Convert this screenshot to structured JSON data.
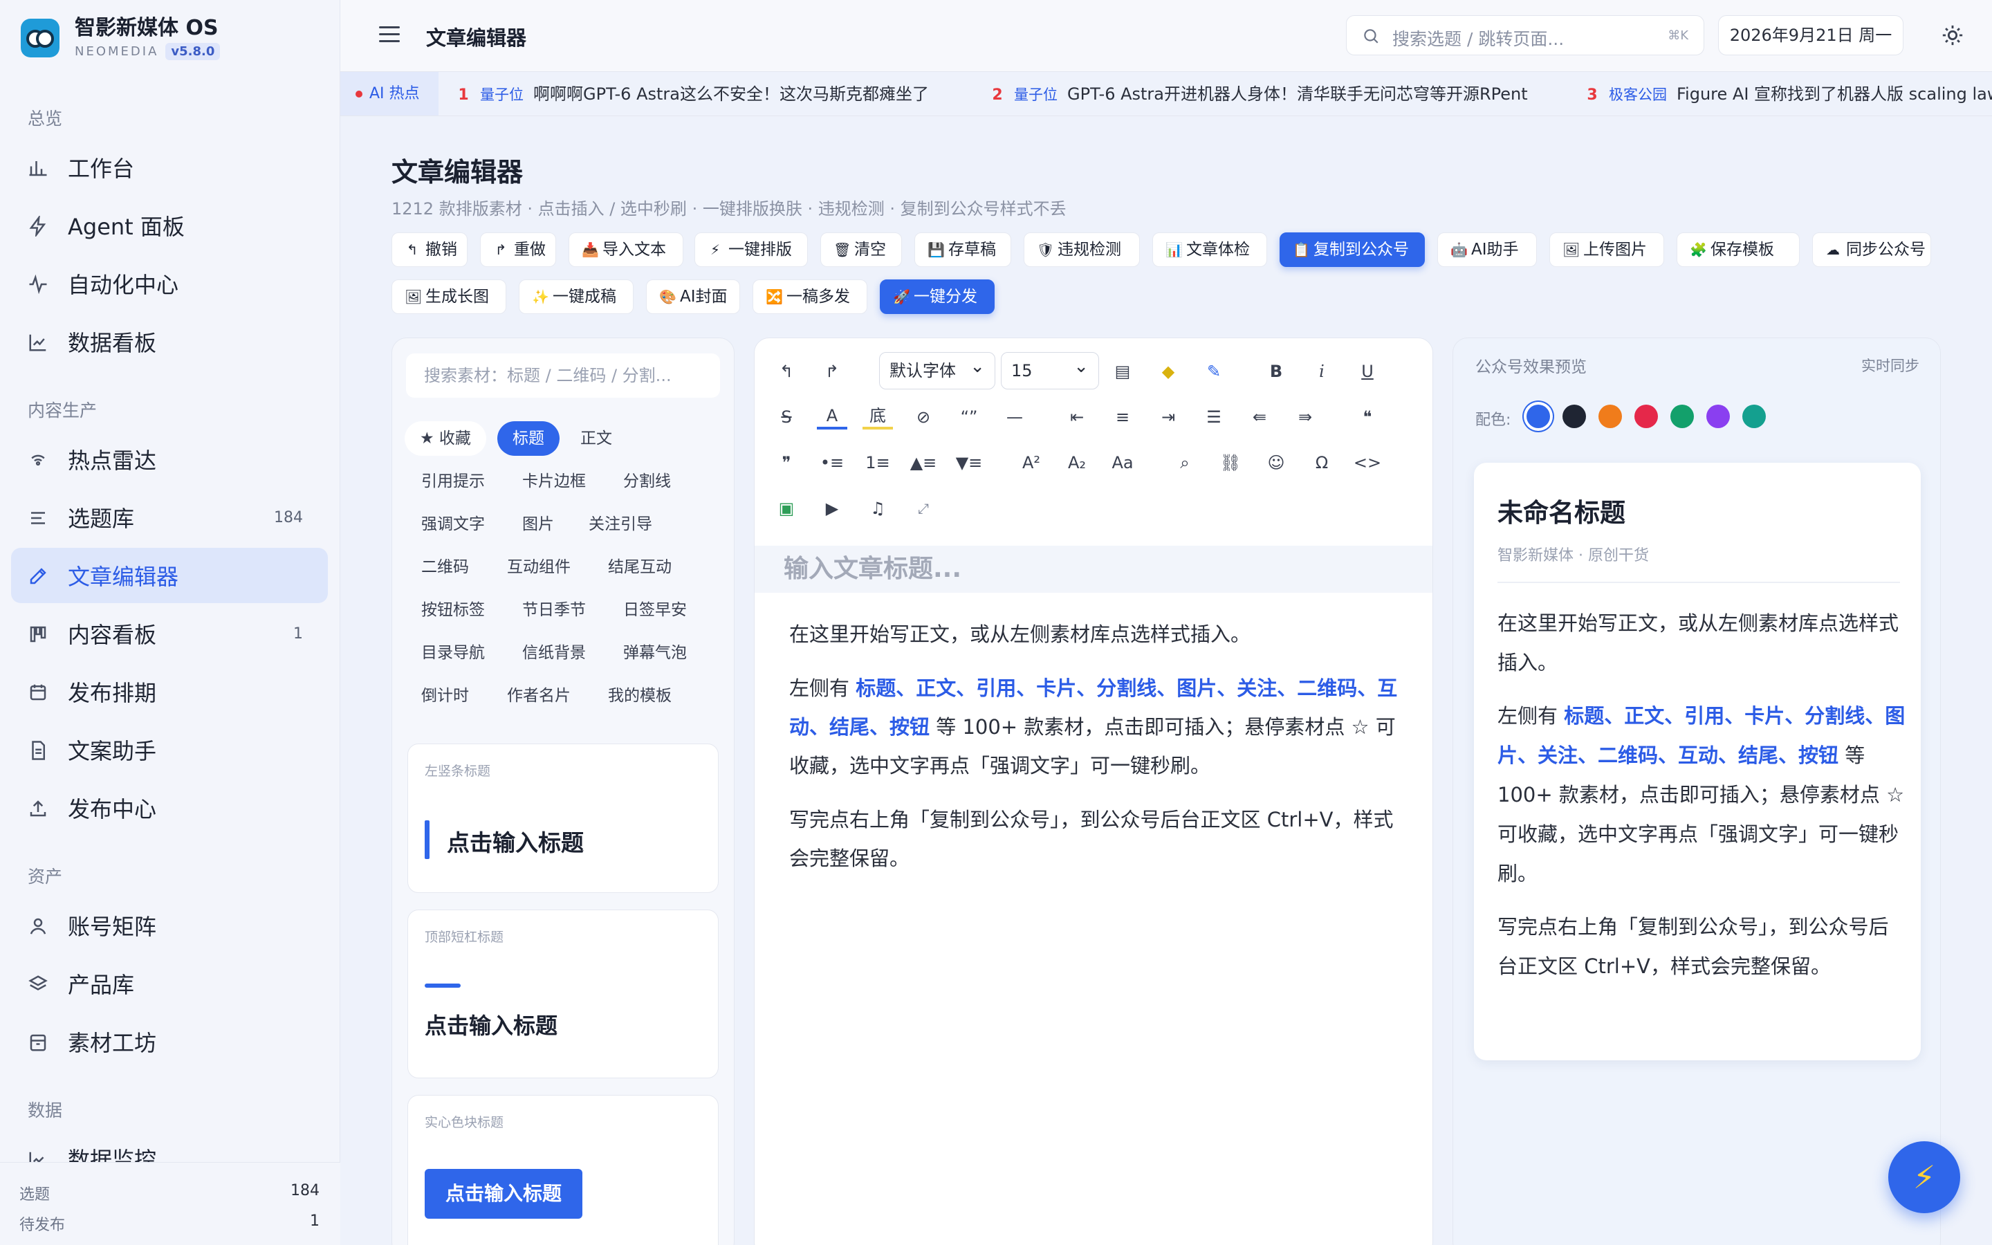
{
  "app": {
    "name": "智影新媒体 OS",
    "sub": "NEOMEDIA",
    "version": "v5.8.0"
  },
  "topbar": {
    "title": "文章编辑器",
    "search_placeholder": "搜索选题 / 跳转页面...",
    "search_kbd": "⌘K",
    "date": "2026年9月21日 周一"
  },
  "sidebar": {
    "sections": [
      "总览",
      "内容生产",
      "资产",
      "数据"
    ],
    "items": [
      {
        "label": "工作台",
        "icon": "bar-chart-icon"
      },
      {
        "label": "Agent 面板",
        "icon": "bolt-icon"
      },
      {
        "label": "自动化中心",
        "icon": "activity-icon"
      },
      {
        "label": "数据看板",
        "icon": "line-chart-icon"
      },
      {
        "label": "热点雷达",
        "icon": "radar-icon"
      },
      {
        "label": "选题库",
        "icon": "list-icon",
        "badge": "184"
      },
      {
        "label": "文章编辑器",
        "icon": "edit-icon",
        "active": true
      },
      {
        "label": "内容看板",
        "icon": "kanban-icon",
        "badge": "1"
      },
      {
        "label": "发布排期",
        "icon": "calendar-icon"
      },
      {
        "label": "文案助手",
        "icon": "document-icon"
      },
      {
        "label": "发布中心",
        "icon": "upload-icon"
      },
      {
        "label": "账号矩阵",
        "icon": "user-icon"
      },
      {
        "label": "产品库",
        "icon": "layers-icon"
      },
      {
        "label": "素材工坊",
        "icon": "archive-icon"
      },
      {
        "label": "数据监控",
        "icon": "monitor-icon"
      }
    ],
    "footer": [
      {
        "label": "选题",
        "value": "184"
      },
      {
        "label": "待发布",
        "value": "1"
      }
    ]
  },
  "ticker": {
    "label": "AI 热点",
    "items": [
      {
        "num": "1",
        "source": "量子位",
        "text": "啊啊啊GPT-6 Astra这么不安全！这次马斯克都瘫坐了"
      },
      {
        "num": "2",
        "source": "量子位",
        "text": "GPT-6 Astra开进机器人身体！清华联手无问芯穹等开源RPent"
      },
      {
        "num": "3",
        "source": "极客公园",
        "text": "Figure AI 宣称找到了机器人版 scaling law"
      }
    ]
  },
  "page": {
    "title": "文章编辑器",
    "subtitle": "1212 款排版素材 · 点击插入 / 选中秒刷 · 一键排版换肤 · 违规检测 · 复制到公众号样式不丢"
  },
  "toolbar": {
    "row1": [
      {
        "icon": "↰",
        "label": "撤销"
      },
      {
        "icon": "↱",
        "label": "重做"
      },
      {
        "icon": "📥",
        "label": "导入文本"
      },
      {
        "icon": "⚡",
        "label": "一键排版"
      },
      {
        "icon": "🗑",
        "label": "清空"
      },
      {
        "icon": "💾",
        "label": "存草稿"
      },
      {
        "icon": "🛡",
        "label": "违规检测"
      },
      {
        "icon": "📊",
        "label": "文章体检"
      },
      {
        "icon": "📋",
        "label": "复制到公众号",
        "primary": true
      },
      {
        "icon": "🤖",
        "label": "AI助手"
      },
      {
        "icon": "🖼",
        "label": "上传图片"
      },
      {
        "icon": "🧩",
        "label": "保存模板"
      },
      {
        "icon": "☁",
        "label": "同步公众号"
      }
    ],
    "row2": [
      {
        "icon": "🖼",
        "label": "生成长图"
      },
      {
        "icon": "✨",
        "label": "一键成稿"
      },
      {
        "icon": "🎨",
        "label": "AI封面"
      },
      {
        "icon": "🔀",
        "label": "一稿多发"
      },
      {
        "icon": "🚀",
        "label": "一键分发",
        "primary": true
      }
    ]
  },
  "materials": {
    "search_placeholder": "搜索素材：标题 / 二维码 / 分割...",
    "chips": [
      "★ 收藏",
      "标题",
      "正文",
      "引用提示",
      "卡片边框",
      "分割线",
      "强调文字",
      "图片",
      "关注引导",
      "二维码",
      "互动组件",
      "结尾互动",
      "按钮标签",
      "节日季节",
      "日签早安",
      "目录导航",
      "信纸背景",
      "弹幕气泡",
      "倒计时",
      "作者名片",
      "我的模板"
    ],
    "cards": [
      {
        "tag": "左竖条标题",
        "text": "点击输入标题"
      },
      {
        "tag": "顶部短杠标题",
        "text": "点击输入标题"
      },
      {
        "tag": "实心色块标题",
        "text": "点击输入标题"
      }
    ]
  },
  "editor": {
    "font": "默认字体",
    "size": "15",
    "title_placeholder": "输入文章标题...",
    "p1": "在这里开始写正文，或从左侧素材库点选样式插入。",
    "p2_a": "左侧有 ",
    "p2_hl": "标题、正文、引用、卡片、分割线、图片、关注、二维码、互动、结尾、按钮",
    "p2_b": " 等 100+ 款素材，点击即可插入；悬停素材点 ☆ 可收藏，选中文字再点「强调文字」可一键秒刷。",
    "p3": "写完点右上角「复制到公众号」，到公众号后台正文区 Ctrl+V，样式会完整保留。"
  },
  "preview": {
    "header": "公众号效果预览",
    "sync": "实时同步",
    "color_label": "配色:",
    "colors": [
      "#2f66ea",
      "#1f2533",
      "#f07c1b",
      "#e5284a",
      "#13a06b",
      "#8a3ff0",
      "#14a08f"
    ],
    "title": "未命名标题",
    "meta": "智影新媒体 · 原创干货"
  }
}
